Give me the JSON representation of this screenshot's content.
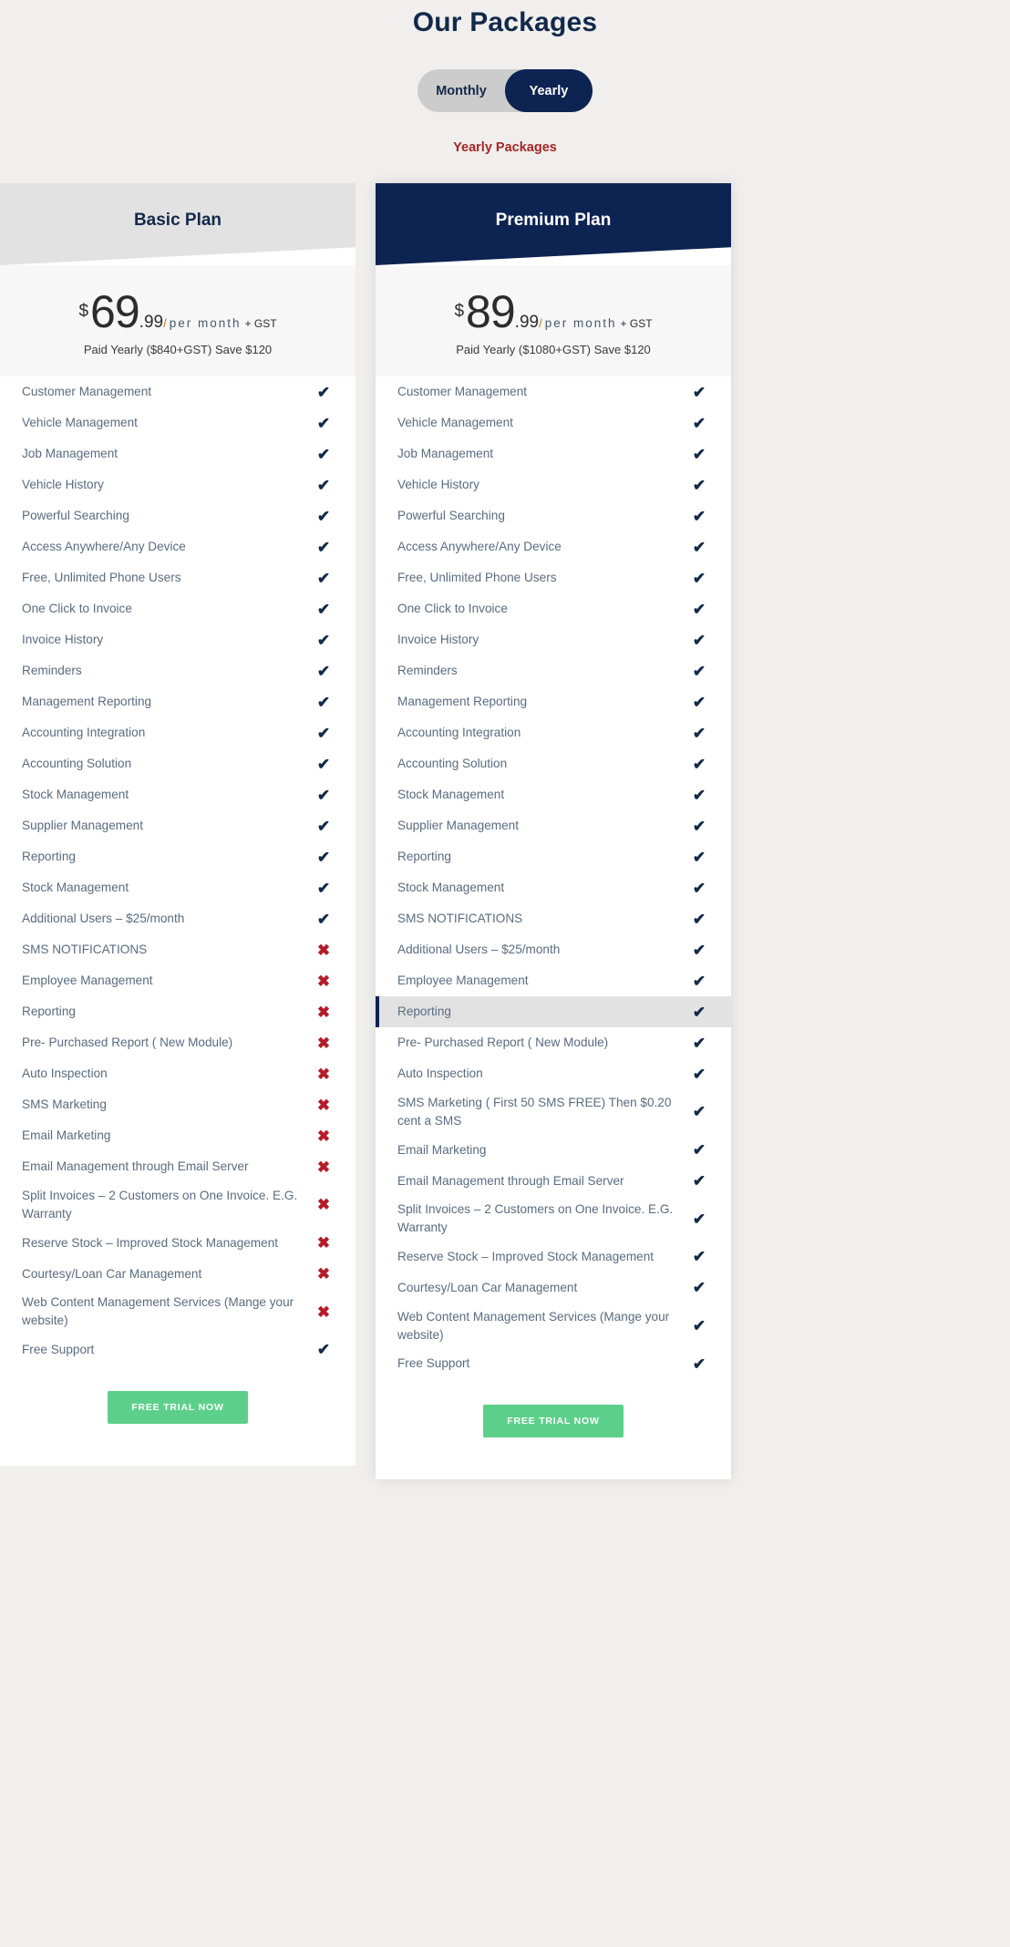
{
  "header": {
    "title": "Our Packages",
    "toggle": {
      "monthly_label": "Monthly",
      "yearly_label": "Yearly",
      "selected": "Yearly"
    },
    "subtitle": "Yearly Packages",
    "accent_color": "#0d2352",
    "subtitle_color": "#a32525"
  },
  "plans": [
    {
      "name": "Basic Plan",
      "currency": "$",
      "amount": "69",
      "cents": ".99",
      "slash": "/",
      "per": "per month",
      "gst": "+ GST",
      "paid_note": "Paid Yearly ($840+GST) Save $120",
      "cta_label": "FREE TRIAL NOW",
      "features": [
        {
          "label": "Customer Management",
          "mark": "yes"
        },
        {
          "label": "Vehicle Management",
          "mark": "yes"
        },
        {
          "label": "Job Management",
          "mark": "yes"
        },
        {
          "label": "Vehicle History",
          "mark": "yes"
        },
        {
          "label": "Powerful Searching",
          "mark": "yes"
        },
        {
          "label": "Access Anywhere/Any Device",
          "mark": "yes"
        },
        {
          "label": "Free, Unlimited Phone Users",
          "mark": "yes"
        },
        {
          "label": "One Click to Invoice",
          "mark": "yes"
        },
        {
          "label": "Invoice History",
          "mark": "yes"
        },
        {
          "label": "Reminders",
          "mark": "yes"
        },
        {
          "label": "Management Reporting",
          "mark": "yes"
        },
        {
          "label": "Accounting Integration",
          "mark": "yes"
        },
        {
          "label": "Accounting Solution",
          "mark": "yes"
        },
        {
          "label": "Stock Management",
          "mark": "yes"
        },
        {
          "label": "Supplier Management",
          "mark": "yes"
        },
        {
          "label": "Reporting",
          "mark": "yes"
        },
        {
          "label": "Stock Management",
          "mark": "yes"
        },
        {
          "label": "Additional Users – $25/month",
          "mark": "yes"
        },
        {
          "label": "SMS NOTIFICATIONS",
          "mark": "no"
        },
        {
          "label": "Employee Management",
          "mark": "no"
        },
        {
          "label": "Reporting",
          "mark": "no"
        },
        {
          "label": "Pre- Purchased Report ( New Module)",
          "mark": "no"
        },
        {
          "label": "Auto Inspection",
          "mark": "no"
        },
        {
          "label": "SMS Marketing",
          "mark": "no"
        },
        {
          "label": "Email Marketing",
          "mark": "no"
        },
        {
          "label": "Email Management through Email Server",
          "mark": "no"
        },
        {
          "label": "Split Invoices – 2 Customers on One Invoice. E.G. Warranty",
          "mark": "no"
        },
        {
          "label": "Reserve Stock – Improved Stock Management",
          "mark": "no"
        },
        {
          "label": "Courtesy/Loan Car Management",
          "mark": "no"
        },
        {
          "label": "Web Content Management Services (Mange your website)",
          "mark": "no"
        },
        {
          "label": "Free Support",
          "mark": "yes"
        }
      ]
    },
    {
      "name": "Premium Plan",
      "currency": "$",
      "amount": "89",
      "cents": ".99",
      "slash": "/",
      "per": "per month",
      "gst": "+ GST",
      "paid_note": "Paid Yearly ($1080+GST) Save $120",
      "cta_label": "FREE TRIAL NOW",
      "features": [
        {
          "label": "Customer Management",
          "mark": "yes"
        },
        {
          "label": "Vehicle Management",
          "mark": "yes"
        },
        {
          "label": "Job Management",
          "mark": "yes"
        },
        {
          "label": "Vehicle History",
          "mark": "yes"
        },
        {
          "label": "Powerful Searching",
          "mark": "yes"
        },
        {
          "label": "Access Anywhere/Any Device",
          "mark": "yes"
        },
        {
          "label": "Free, Unlimited Phone Users",
          "mark": "yes"
        },
        {
          "label": "One Click to Invoice",
          "mark": "yes"
        },
        {
          "label": "Invoice History",
          "mark": "yes"
        },
        {
          "label": "Reminders",
          "mark": "yes"
        },
        {
          "label": "Management Reporting",
          "mark": "yes"
        },
        {
          "label": "Accounting Integration",
          "mark": "yes"
        },
        {
          "label": "Accounting Solution",
          "mark": "yes"
        },
        {
          "label": "Stock Management",
          "mark": "yes"
        },
        {
          "label": "Supplier Management",
          "mark": "yes"
        },
        {
          "label": "Reporting",
          "mark": "yes"
        },
        {
          "label": "Stock Management",
          "mark": "yes"
        },
        {
          "label": "SMS NOTIFICATIONS",
          "mark": "yes"
        },
        {
          "label": "Additional Users – $25/month",
          "mark": "yes"
        },
        {
          "label": "Employee Management",
          "mark": "yes"
        },
        {
          "label": "Reporting",
          "mark": "yes",
          "highlight": true
        },
        {
          "label": "Pre- Purchased Report ( New Module)",
          "mark": "yes"
        },
        {
          "label": "Auto Inspection",
          "mark": "yes"
        },
        {
          "label": "SMS Marketing ( First 50 SMS FREE) Then $0.20 cent a SMS",
          "mark": "yes"
        },
        {
          "label": "Email Marketing",
          "mark": "yes"
        },
        {
          "label": "Email Management through Email Server",
          "mark": "yes"
        },
        {
          "label": "Split Invoices – 2 Customers on One Invoice. E.G. Warranty",
          "mark": "yes"
        },
        {
          "label": "Reserve Stock – Improved Stock Management",
          "mark": "yes"
        },
        {
          "label": "Courtesy/Loan Car Management",
          "mark": "yes"
        },
        {
          "label": "Web Content Management Services (Mange your website)",
          "mark": "yes"
        },
        {
          "label": "Free Support",
          "mark": "yes"
        }
      ]
    }
  ],
  "icons": {
    "check": "✔",
    "cross": "✖"
  }
}
